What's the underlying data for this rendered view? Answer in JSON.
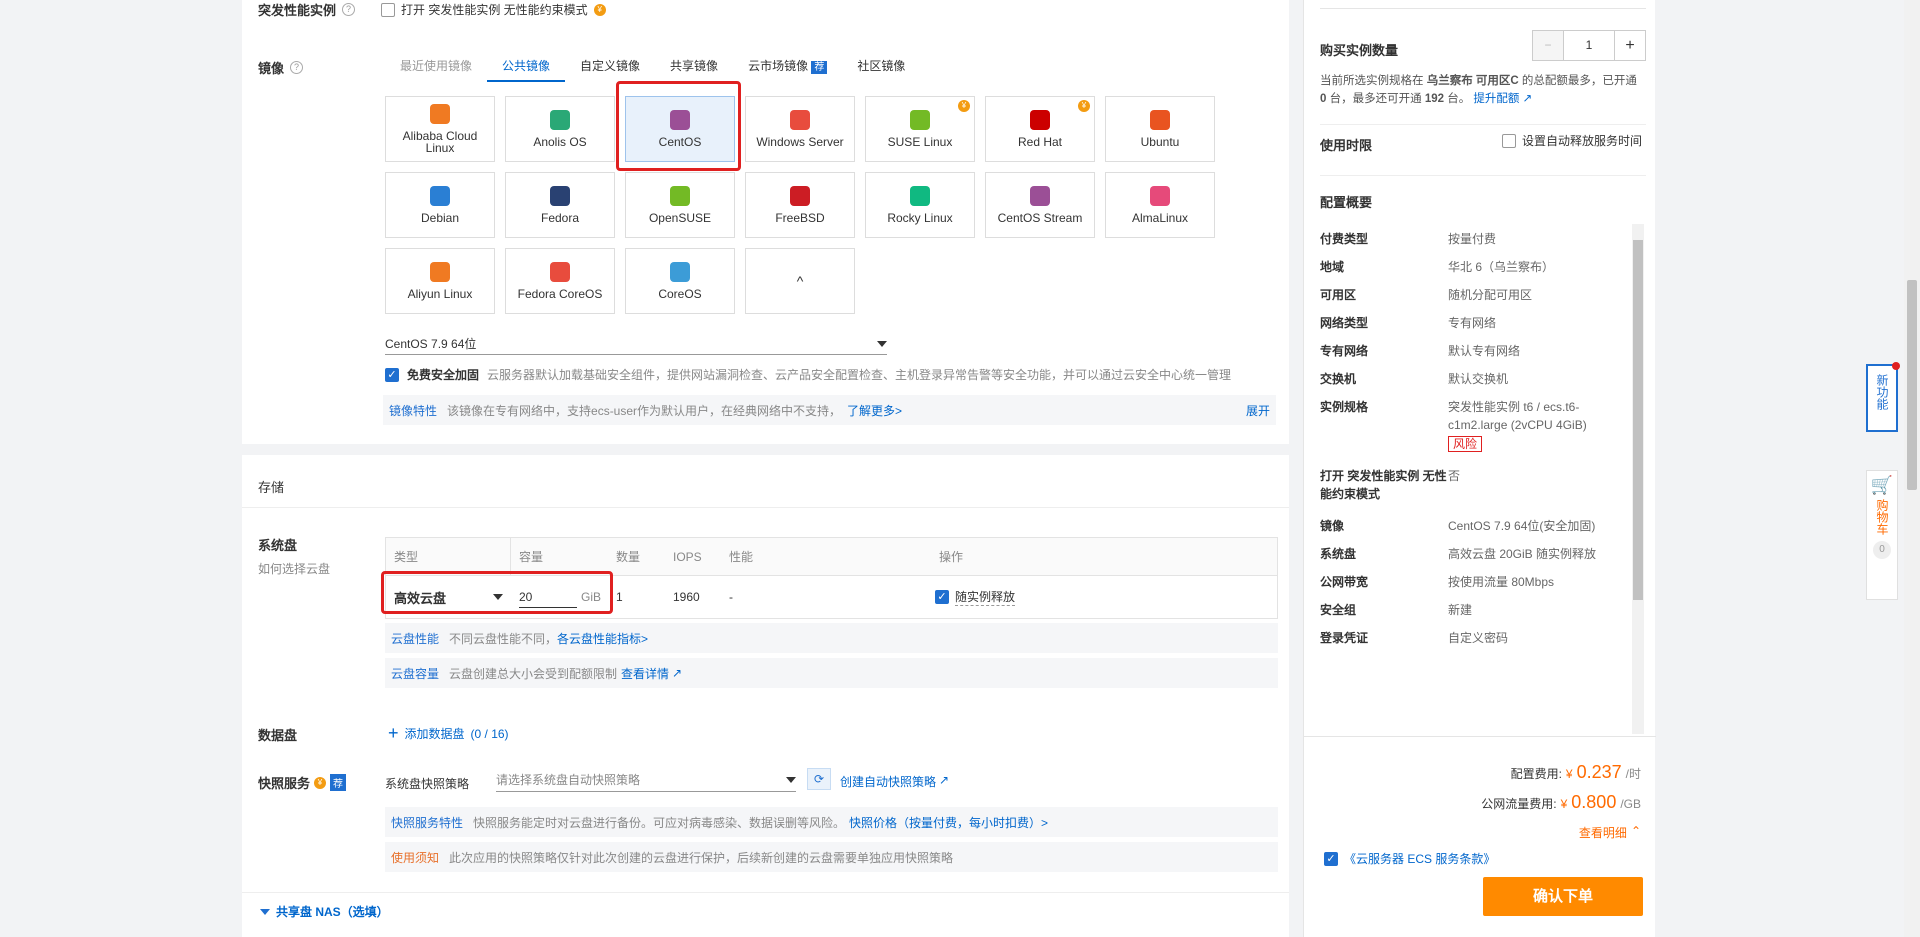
{
  "burst": {
    "label": "突发性能实例",
    "option": "打开 突发性能实例 无性能约束模式"
  },
  "image": {
    "label": "镜像",
    "tabs": [
      {
        "label": "最近使用镜像",
        "state": "dim"
      },
      {
        "label": "公共镜像",
        "state": "active"
      },
      {
        "label": "自定义镜像",
        "state": ""
      },
      {
        "label": "共享镜像",
        "state": ""
      },
      {
        "label": "云市场镜像",
        "state": "",
        "badge": "荐"
      },
      {
        "label": "社区镜像",
        "state": ""
      }
    ],
    "os_list": [
      {
        "name": "Alibaba Cloud Linux",
        "icon": "alibaba-cloud-linux-icon",
        "color": "#f07a22"
      },
      {
        "name": "Anolis OS",
        "icon": "anolis-os-icon",
        "color": "#2aa876"
      },
      {
        "name": "CentOS",
        "icon": "centos-icon",
        "color": "#9b4f96",
        "selected": true
      },
      {
        "name": "Windows Server",
        "icon": "windows-icon",
        "color": "#e84c3d"
      },
      {
        "name": "SUSE Linux",
        "icon": "suse-icon",
        "color": "#73ba25",
        "paid": true
      },
      {
        "name": "Red Hat",
        "icon": "red-hat-icon",
        "color": "#cc0000",
        "paid": true
      },
      {
        "name": "Ubuntu",
        "icon": "ubuntu-icon",
        "color": "#e95420"
      },
      {
        "name": "Debian",
        "icon": "debian-icon",
        "color": "#2a7fd4"
      },
      {
        "name": "Fedora",
        "icon": "fedora-icon",
        "color": "#294172"
      },
      {
        "name": "OpenSUSE",
        "icon": "opensuse-icon",
        "color": "#73ba25"
      },
      {
        "name": "FreeBSD",
        "icon": "freebsd-icon",
        "color": "#cc1d24"
      },
      {
        "name": "Rocky Linux",
        "icon": "rocky-linux-icon",
        "color": "#10b981"
      },
      {
        "name": "CentOS Stream",
        "icon": "centos-stream-icon",
        "color": "#9b4f96"
      },
      {
        "name": "AlmaLinux",
        "icon": "almalinux-icon",
        "color": "#e64a7a"
      },
      {
        "name": "Aliyun Linux",
        "icon": "aliyun-linux-icon",
        "color": "#f07a22"
      },
      {
        "name": "Fedora CoreOS",
        "icon": "fedora-coreos-icon",
        "color": "#e84c3d"
      },
      {
        "name": "CoreOS",
        "icon": "coreos-icon",
        "color": "#3c9cd7"
      }
    ],
    "collapse_symbol": "^",
    "version": "CentOS 7.9 64位",
    "security": {
      "label": "免费安全加固",
      "desc": "云服务器默认加载基础安全组件，提供网站漏洞检查、云产品安全配置检查、主机登录异常告警等安全功能，并可以通过云安全中心统一管理"
    },
    "feature": {
      "tag": "镜像特性",
      "desc": "该镜像在专有网络中，支持ecs-user作为默认用户，在经典网络中不支持，",
      "link": "了解更多>",
      "expand": "展开"
    }
  },
  "storage": {
    "title": "存储",
    "system_disk": {
      "label": "系统盘",
      "help_link": "如何选择云盘",
      "columns": [
        "类型",
        "容量",
        "数量",
        "IOPS",
        "性能",
        "操作"
      ],
      "type": "高效云盘",
      "capacity": "20",
      "unit": "GiB",
      "count": "1",
      "iops": "1960",
      "perf": "-",
      "release": "随实例释放"
    },
    "perf_info": {
      "tag": "云盘性能",
      "desc": "不同云盘性能不同，",
      "link": "各云盘性能指标>"
    },
    "cap_info": {
      "tag": "云盘容量",
      "desc": "云盘创建总大小会受到配额限制",
      "link": "查看详情"
    },
    "data_disk": {
      "label": "数据盘",
      "add": "添加数据盘",
      "count": "(0 / 16)"
    },
    "snapshot": {
      "label": "快照服务",
      "badge": "荐",
      "policy_label": "系统盘快照策略",
      "policy_placeholder": "请选择系统盘自动快照策略",
      "create_link": "创建自动快照策略",
      "feature_tag": "快照服务特性",
      "feature_desc": "快照服务能定时对云盘进行备份。可应对病毒感染、数据误删等风险。",
      "feature_link": "快照价格（按量付费，每小时扣费）>",
      "notice_tag": "使用须知",
      "notice_desc": "此次应用的快照策略仅针对此次创建的云盘进行保护，后续新创建的云盘需要单独应用快照策略"
    },
    "nas": "共享盘 NAS（选填）"
  },
  "right": {
    "qty_label": "购买实例数量",
    "qty_value": "1",
    "qty_minus": "−",
    "qty_plus": "+",
    "quota_text1": "当前所选实例规格在",
    "quota_region": "乌兰察布 可用区C",
    "quota_text2": "的总配额最多，已开通",
    "quota_opened": "0",
    "quota_text3": "台，最多还可开通",
    "quota_max": "192",
    "quota_text4": "台。",
    "quota_link": "提升配额",
    "duration_label": "使用时限",
    "auto_release": "设置自动释放服务时间",
    "summary_title": "配置概要",
    "summary": [
      {
        "k": "付费类型",
        "v": "按量付费"
      },
      {
        "k": "地域",
        "v": "华北 6（乌兰察布）"
      },
      {
        "k": "可用区",
        "v": "随机分配可用区"
      },
      {
        "k": "网络类型",
        "v": "专有网络"
      },
      {
        "k": "专有网络",
        "v": "默认专有网络"
      },
      {
        "k": "交换机",
        "v": "默认交换机"
      },
      {
        "k": "实例规格",
        "v": "突发性能实例 t6 / ecs.t6-c1m2.large (2vCPU 4GiB)",
        "risk": "风险"
      },
      {
        "k": "打开 突发性能实例 无性能约束模式",
        "v": "否"
      },
      {
        "k": "镜像",
        "v": "CentOS 7.9 64位(安全加固)"
      },
      {
        "k": "系统盘",
        "v": "高效云盘 20GiB 随实例释放"
      },
      {
        "k": "公网带宽",
        "v": "按使用流量 80Mbps"
      },
      {
        "k": "安全组",
        "v": "新建"
      },
      {
        "k": "登录凭证",
        "v": "自定义密码"
      }
    ],
    "config_fee_label": "配置费用:",
    "config_fee_currency": "¥",
    "config_fee": "0.237",
    "config_fee_unit": "/时",
    "traffic_fee_label": "公网流量费用:",
    "traffic_fee_currency": "¥",
    "traffic_fee": "0.800",
    "traffic_fee_unit": "/GB",
    "detail_link": "查看明细",
    "terms": "《云服务器 ECS 服务条款》",
    "confirm": "确认下单"
  },
  "side": {
    "new_feature": "新功能",
    "cart": "购物车",
    "cart_count": "0"
  },
  "colors": {
    "accent": "#0066cc",
    "orange": "#ff8a00",
    "price": "#ff6a00",
    "highlight": "#e02020"
  }
}
